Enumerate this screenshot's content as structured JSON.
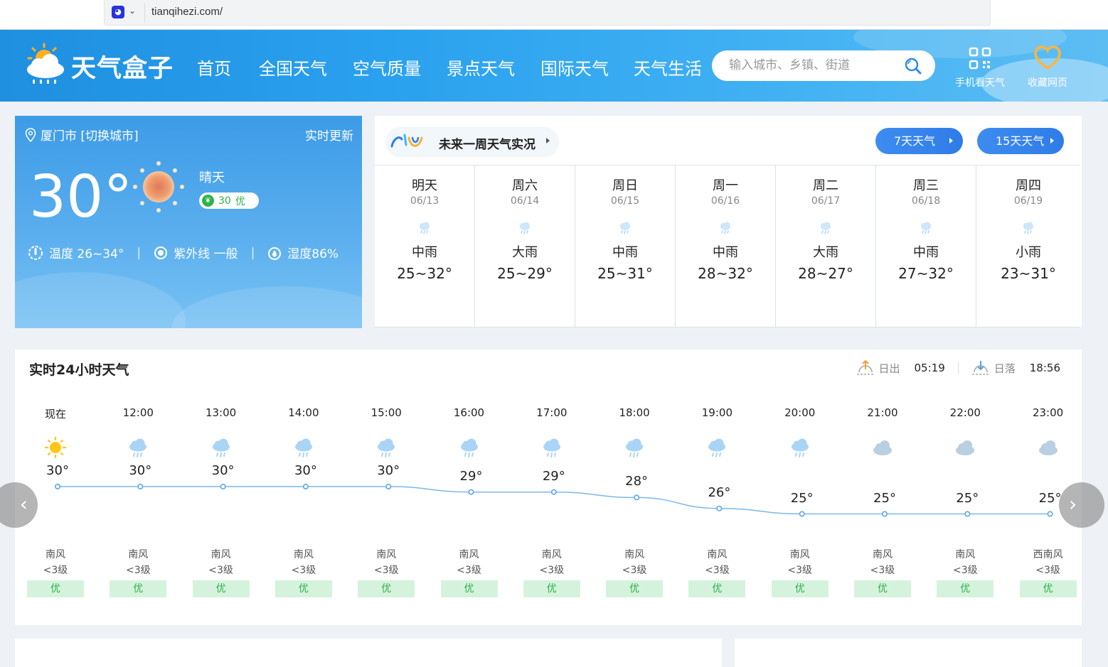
{
  "browser": {
    "url": "tianqihezi.com/"
  },
  "header": {
    "logo_text": "天气盒子",
    "nav": [
      "首页",
      "全国天气",
      "空气质量",
      "景点天气",
      "国际天气",
      "天气生活"
    ],
    "search_placeholder": "输入城市、乡镇、街道",
    "mobile_label": "手机看天气",
    "bookmark_label": "收藏网页"
  },
  "now": {
    "city": "厦门市 [切换城市]",
    "update": "实时更新",
    "temp": "30°",
    "condition": "晴天",
    "aqi_value": "30",
    "aqi_level": "优",
    "temp_range": "温度 26~34°",
    "uv": "紫外线 一般",
    "humidity": "湿度86%",
    "sep": "|"
  },
  "week": {
    "title": "未来一周天气实况",
    "btn7": "7天天气",
    "btn15": "15天天气",
    "days": [
      {
        "day": "明天",
        "date": "06/13",
        "cond": "中雨",
        "temp": "25~32°"
      },
      {
        "day": "周六",
        "date": "06/14",
        "cond": "大雨",
        "temp": "25~29°"
      },
      {
        "day": "周日",
        "date": "06/15",
        "cond": "中雨",
        "temp": "25~31°"
      },
      {
        "day": "周一",
        "date": "06/16",
        "cond": "中雨",
        "temp": "28~32°"
      },
      {
        "day": "周二",
        "date": "06/17",
        "cond": "大雨",
        "temp": "28~27°"
      },
      {
        "day": "周三",
        "date": "06/18",
        "cond": "中雨",
        "temp": "27~32°"
      },
      {
        "day": "周四",
        "date": "06/19",
        "cond": "小雨",
        "temp": "23~31°"
      }
    ]
  },
  "hourly": {
    "title": "实时24小时天气",
    "sunrise_label": "日出",
    "sunrise": "05:19",
    "sunset_label": "日落",
    "sunset": "18:56",
    "prev_label": "‹",
    "next_label": "›",
    "hours": [
      {
        "time": "现在",
        "icon": "sun-icon",
        "temp": "30°",
        "t": 30,
        "wind": "南风",
        "level": "<3级",
        "aqi": "优"
      },
      {
        "time": "12:00",
        "icon": "rain-cloud-icon",
        "temp": "30°",
        "t": 30,
        "wind": "南风",
        "level": "<3级",
        "aqi": "优"
      },
      {
        "time": "13:00",
        "icon": "rain-cloud-icon",
        "temp": "30°",
        "t": 30,
        "wind": "南风",
        "level": "<3级",
        "aqi": "优"
      },
      {
        "time": "14:00",
        "icon": "rain-cloud-icon",
        "temp": "30°",
        "t": 30,
        "wind": "南风",
        "level": "<3级",
        "aqi": "优"
      },
      {
        "time": "15:00",
        "icon": "rain-cloud-icon",
        "temp": "30°",
        "t": 30,
        "wind": "南风",
        "level": "<3级",
        "aqi": "优"
      },
      {
        "time": "16:00",
        "icon": "rain-cloud-icon",
        "temp": "29°",
        "t": 29,
        "wind": "南风",
        "level": "<3级",
        "aqi": "优"
      },
      {
        "time": "17:00",
        "icon": "rain-cloud-icon",
        "temp": "29°",
        "t": 29,
        "wind": "南风",
        "level": "<3级",
        "aqi": "优"
      },
      {
        "time": "18:00",
        "icon": "rain-cloud-icon",
        "temp": "28°",
        "t": 28,
        "wind": "南风",
        "level": "<3级",
        "aqi": "优"
      },
      {
        "time": "19:00",
        "icon": "rain-cloud-icon",
        "temp": "26°",
        "t": 26,
        "wind": "南风",
        "level": "<3级",
        "aqi": "优"
      },
      {
        "time": "20:00",
        "icon": "rain-cloud-icon",
        "temp": "25°",
        "t": 25,
        "wind": "南风",
        "level": "<3级",
        "aqi": "优"
      },
      {
        "time": "21:00",
        "icon": "cloud-icon",
        "temp": "25°",
        "t": 25,
        "wind": "南风",
        "level": "<3级",
        "aqi": "优"
      },
      {
        "time": "22:00",
        "icon": "cloud-icon",
        "temp": "25°",
        "t": 25,
        "wind": "南风",
        "level": "<3级",
        "aqi": "优"
      },
      {
        "time": "23:00",
        "icon": "cloud-icon",
        "temp": "25°",
        "t": 25,
        "wind": "西南风",
        "level": "<3级",
        "aqi": "优"
      }
    ]
  },
  "colors": {
    "accent": "#2f7ce8",
    "header": "#2aa1ee",
    "good_aqi": "#2fae4a",
    "curve": "#7ab8ea"
  }
}
